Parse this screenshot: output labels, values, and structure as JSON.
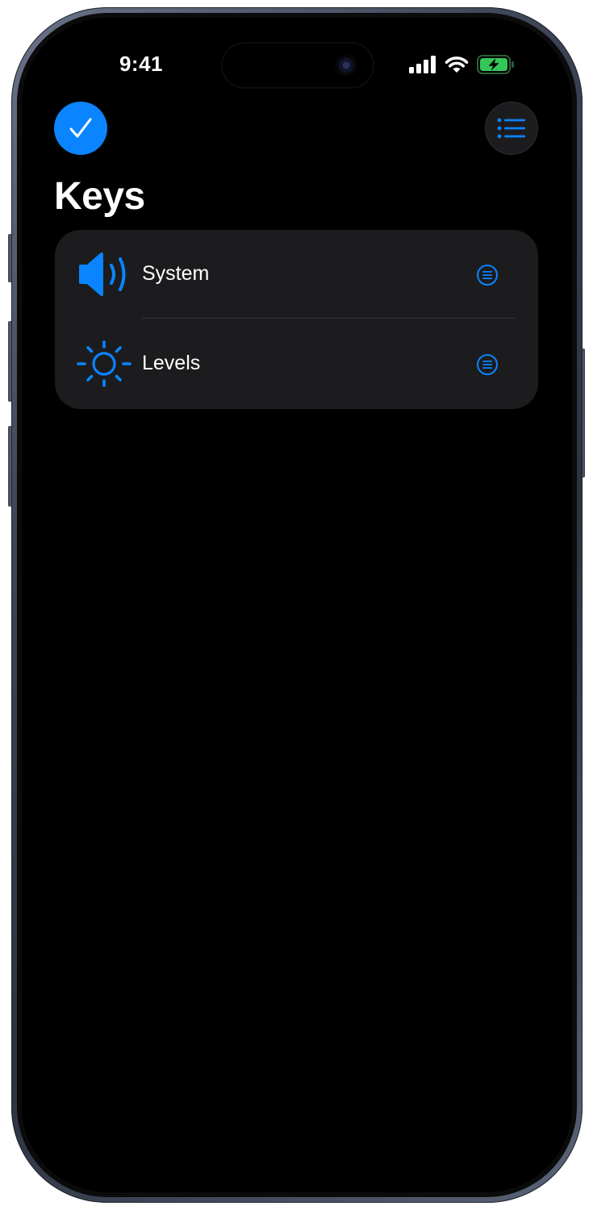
{
  "status_bar": {
    "time": "9:41",
    "icons": [
      "cellular-signal-icon",
      "wifi-icon",
      "battery-charging-icon"
    ]
  },
  "nav": {
    "done_icon": "checkmark-icon",
    "menu_icon": "list-icon"
  },
  "page": {
    "title": "Keys"
  },
  "keys": [
    {
      "label": "System",
      "icon": "speaker-volume-icon",
      "action_icon": "list-circle-icon"
    },
    {
      "label": "Levels",
      "icon": "sun-brightness-icon",
      "action_icon": "list-circle-icon"
    }
  ],
  "colors": {
    "accent": "#0a84ff",
    "background": "#000000",
    "card": "#1c1c1e",
    "battery": "#34c759"
  }
}
